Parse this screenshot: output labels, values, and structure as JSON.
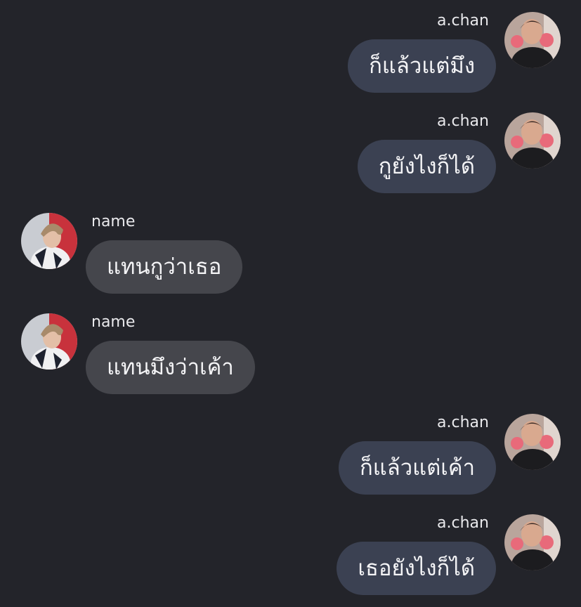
{
  "colors": {
    "background": "#23242a",
    "outgoing_bubble": "#3b4152",
    "incoming_bubble": "#45464c",
    "text": "#f4f4f6"
  },
  "messages": [
    {
      "side": "right",
      "sender": "a.chan",
      "text": "ก็แล้วแต่มึง",
      "avatar": "achan-avatar"
    },
    {
      "side": "right",
      "sender": "a.chan",
      "text": "กูยังไงก็ได้",
      "avatar": "achan-avatar"
    },
    {
      "side": "left",
      "sender": "name",
      "text": "แทนกูว่าเธอ",
      "avatar": "name-avatar"
    },
    {
      "side": "left",
      "sender": "name",
      "text": "แทนมึงว่าเค้า",
      "avatar": "name-avatar"
    },
    {
      "side": "right",
      "sender": "a.chan",
      "text": "ก็แล้วแต่เค้า",
      "avatar": "achan-avatar"
    },
    {
      "side": "right",
      "sender": "a.chan",
      "text": "เธอยังไงก็ได้",
      "avatar": "achan-avatar"
    }
  ]
}
